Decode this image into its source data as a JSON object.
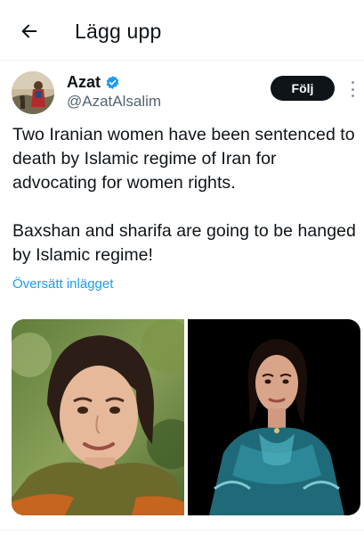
{
  "header": {
    "title": "Lägg upp",
    "back_icon": "arrow-left-icon"
  },
  "author": {
    "name": "Azat",
    "handle": "@AzatAlsalim",
    "verified": true,
    "verified_color": "#1d9bf0"
  },
  "actions": {
    "follow_label": "Följ",
    "more_icon": "vertical-ellipsis-icon"
  },
  "tweet": {
    "text": "Two Iranian women have been sentenced to death by Islamic regime of Iran for advocating for women rights.\n\nBaxshan and sharifa are going to be hanged by Islamic regime!",
    "translate_label": "Översätt inlägget"
  },
  "media": {
    "count": 2
  },
  "colors": {
    "accent": "#1d9bf0",
    "text": "#0f1419",
    "secondary_text": "#536471",
    "follow_bg": "#0f1419"
  }
}
